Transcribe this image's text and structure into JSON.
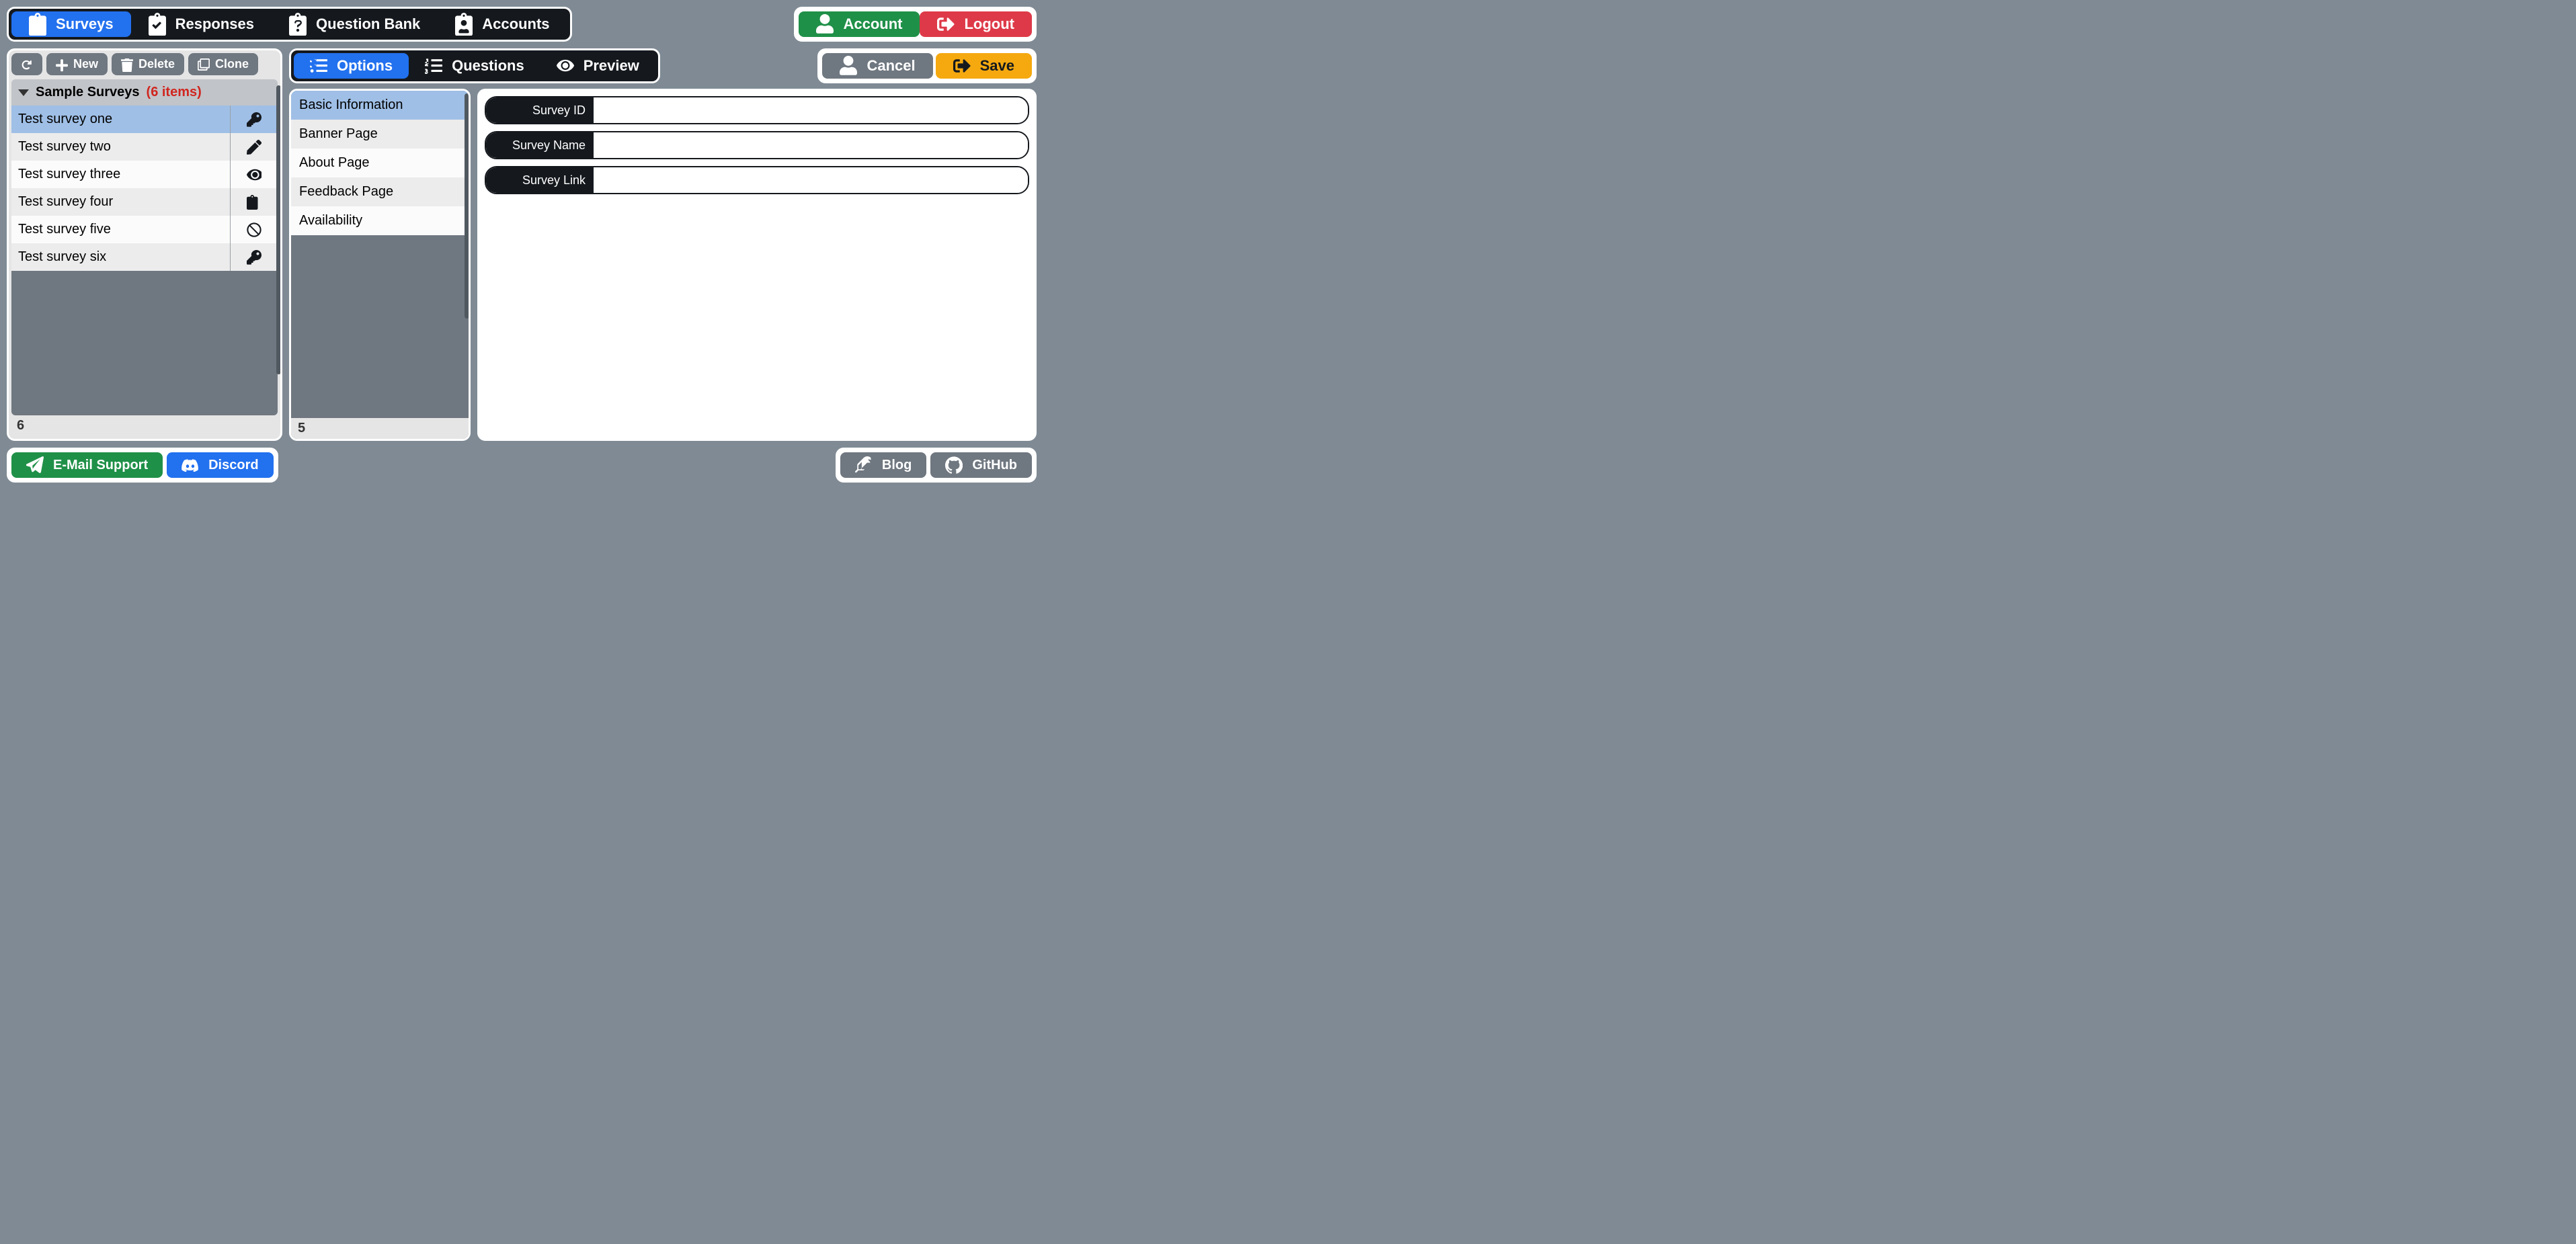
{
  "topnav": {
    "surveys": "Surveys",
    "responses": "Responses",
    "question_bank": "Question Bank",
    "accounts": "Accounts",
    "account": "Account",
    "logout": "Logout"
  },
  "toolbar": {
    "new": "New",
    "delete": "Delete",
    "clone": "Clone"
  },
  "group": {
    "title": "Sample Surveys",
    "count_label": "(6 items)"
  },
  "surveys": [
    {
      "name": "Test survey one",
      "status": "key"
    },
    {
      "name": "Test survey two",
      "status": "pencil"
    },
    {
      "name": "Test survey three",
      "status": "eye"
    },
    {
      "name": "Test survey four",
      "status": "clipboard"
    },
    {
      "name": "Test survey five",
      "status": "ban"
    },
    {
      "name": "Test survey six",
      "status": "key"
    }
  ],
  "survey_count": "6",
  "subnav": {
    "options": "Options",
    "questions": "Questions",
    "preview": "Preview"
  },
  "actions": {
    "cancel": "Cancel",
    "save": "Save"
  },
  "option_sections": [
    "Basic Information",
    "Banner Page",
    "About Page",
    "Feedback Page",
    "Availability"
  ],
  "option_count": "5",
  "form": {
    "survey_id_label": "Survey ID",
    "survey_id_value": "",
    "survey_name_label": "Survey Name",
    "survey_name_value": "",
    "survey_link_label": "Survey Link",
    "survey_link_value": ""
  },
  "footer": {
    "email_support": "E-Mail Support",
    "discord": "Discord",
    "blog": "Blog",
    "github": "GitHub"
  }
}
